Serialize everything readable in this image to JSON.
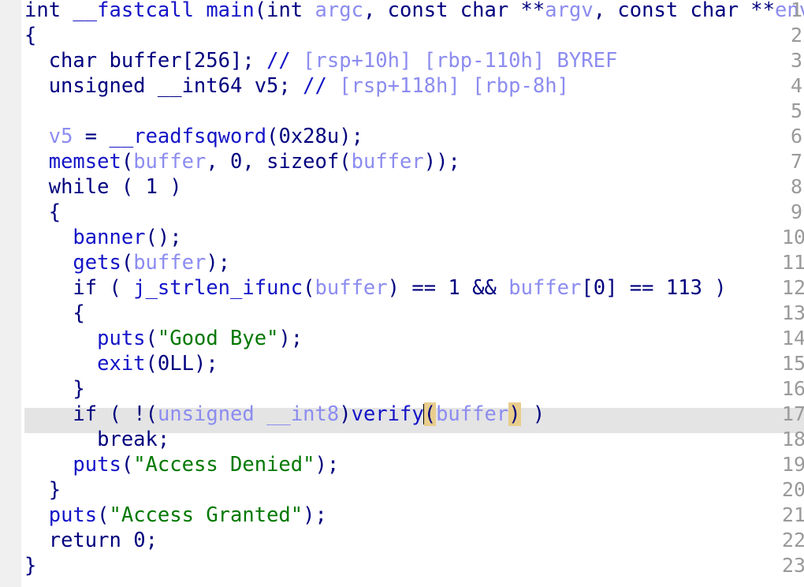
{
  "window": {
    "kind": "decompiler-pseudocode-view",
    "background_color": "#ffffff",
    "gutter_color": "#f0f0f0",
    "gutter_text_color": "#9a9a9a",
    "highlight_row_color": "#e4e4e4",
    "matched_paren_color": "#e8cd8c",
    "caret_color": "#000000"
  },
  "colors": {
    "punctuation": "#00007f",
    "keyword": "#00007f",
    "function": "#1414c8",
    "variable": "#8c8cf0",
    "comment": "#8c8cf0",
    "comment_slashes": "#1414c8",
    "string": "#007800",
    "number": "#00007f"
  },
  "caret": {
    "line": 17,
    "after_token": "verify"
  },
  "current_line": 17,
  "gutter": {
    "line_numbers": [
      "1",
      "2",
      "3",
      "4",
      "5",
      "6",
      "7",
      "8",
      "9",
      "10",
      "11",
      "12",
      "13",
      "14",
      "15",
      "16",
      "17",
      "18",
      "19",
      "20",
      "21",
      "22",
      "23"
    ]
  },
  "code": {
    "language": "c-pseudocode",
    "lines": [
      {
        "n": "1",
        "text": "int __fastcall main(int argc, const char **argv, const char **envp"
      },
      {
        "n": "2",
        "text": "{"
      },
      {
        "n": "3",
        "text": "  char buffer[256]; // [rsp+10h] [rbp-110h] BYREF"
      },
      {
        "n": "4",
        "text": "  unsigned __int64 v5; // [rsp+118h] [rbp-8h]"
      },
      {
        "n": "5",
        "text": ""
      },
      {
        "n": "6",
        "text": "  v5 = __readfsqword(0x28u);"
      },
      {
        "n": "7",
        "text": "  memset(buffer, 0, sizeof(buffer));"
      },
      {
        "n": "8",
        "text": "  while ( 1 )"
      },
      {
        "n": "9",
        "text": "  {"
      },
      {
        "n": "10",
        "text": "    banner();"
      },
      {
        "n": "11",
        "text": "    gets(buffer);"
      },
      {
        "n": "12",
        "text": "    if ( j_strlen_ifunc(buffer) == 1 && buffer[0] == 113 )"
      },
      {
        "n": "13",
        "text": "    {"
      },
      {
        "n": "14",
        "text": "      puts(\"Good Bye\");"
      },
      {
        "n": "15",
        "text": "      exit(0LL);"
      },
      {
        "n": "16",
        "text": "    }"
      },
      {
        "n": "17",
        "text": "    if ( !(unsigned __int8)verify(buffer) )"
      },
      {
        "n": "18",
        "text": "      break;"
      },
      {
        "n": "19",
        "text": "    puts(\"Access Denied\");"
      },
      {
        "n": "20",
        "text": "  }"
      },
      {
        "n": "21",
        "text": "  puts(\"Access Granted\");"
      },
      {
        "n": "22",
        "text": "  return 0;"
      },
      {
        "n": "23",
        "text": "}"
      }
    ],
    "identifiers": {
      "function_name": "main",
      "calling_convention": "__fastcall",
      "parameters": [
        "int argc",
        "const char **argv",
        "const char **envp"
      ],
      "locals": [
        "buffer",
        "v5"
      ],
      "called_functions": [
        "__readfsqword",
        "memset",
        "banner",
        "gets",
        "j_strlen_ifunc",
        "puts",
        "exit",
        "verify"
      ],
      "strings": [
        "Good Bye",
        "Access Denied",
        "Access Granted"
      ],
      "comments": [
        "[rsp+10h] [rbp-110h] BYREF",
        "[rsp+118h] [rbp-8h]"
      ],
      "constants": [
        "256",
        "0x28u",
        "0",
        "1",
        "113",
        "0LL",
        "0"
      ]
    }
  }
}
